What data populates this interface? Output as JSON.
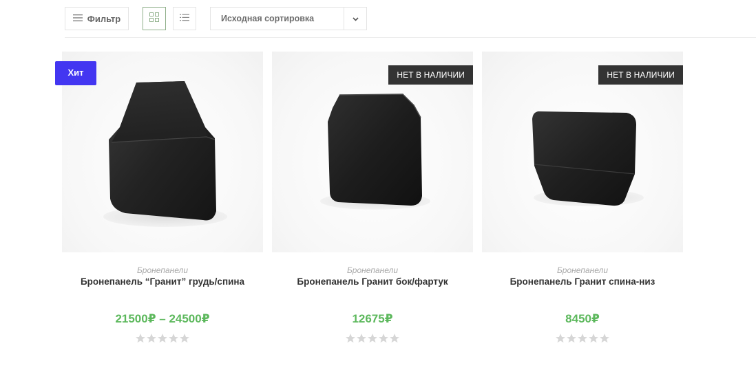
{
  "toolbar": {
    "filter_label": "Фильтр",
    "sort_selected": "Исходная сортировка"
  },
  "colors": {
    "price": "#5cb85c",
    "hit_badge": "#4336f1",
    "out_badge": "#333333"
  },
  "products": [
    {
      "category": "Бронепанели",
      "title": "Бронепанель “Гранит” грудь/спина",
      "price": "21500₽ – 24500₽",
      "badge": "Хит",
      "rating": 0
    },
    {
      "category": "Бронепанели",
      "title": "Бронепанель Гранит бок/фартук",
      "price": "12675₽",
      "badge": "НЕТ В НАЛИЧИИ",
      "rating": 0
    },
    {
      "category": "Бронепанели",
      "title": "Бронепанель Гранит спина-низ",
      "price": "8450₽",
      "badge": "НЕТ В НАЛИЧИИ",
      "rating": 0
    }
  ]
}
